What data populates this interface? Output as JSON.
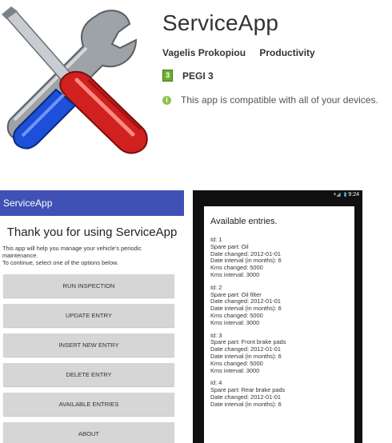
{
  "app": {
    "title": "ServiceApp",
    "developer": "Vagelis Prokopiou",
    "category": "Productivity",
    "rating_badge": "3",
    "rating": "PEGI 3",
    "compat_icon": "info-icon",
    "compatibility": "This app is compatible with all of your devices."
  },
  "screenshot1": {
    "appbar_title": "ServiceApp",
    "heading": "Thank you for using ServiceApp",
    "intro_line1": "This app will help you manage your vehicle's periodic",
    "intro_line2": "maintenance.",
    "intro_line3": "To continue, select one of the options below.",
    "buttons": [
      "RUN INSPECTION",
      "UPDATE ENTRY",
      "INSERT NEW ENTRY",
      "DELETE ENTRY",
      "AVAILABLE ENTRIES",
      "ABOUT"
    ]
  },
  "screenshot2": {
    "status_time": "9:24",
    "title": "Available entries.",
    "entries": [
      {
        "id": "Id: 1",
        "part": "Spare part: Oil",
        "date": "Date changed: 2012-01-01",
        "interval": "Date interval (in months): 6",
        "kms": "Kms changed: 5000",
        "kms_interval": "Kms interval: 3000"
      },
      {
        "id": "Id: 2",
        "part": "Spare part: Oil filter",
        "date": "Date changed: 2012-01-01",
        "interval": "Date interval (in months): 6",
        "kms": "Kms changed: 5000",
        "kms_interval": "Kms interval: 3000"
      },
      {
        "id": "Id: 3",
        "part": "Spare part: Front brake pads",
        "date": "Date changed: 2012-01-01",
        "interval": "Date interval (in months): 6",
        "kms": "Kms changed: 5000",
        "kms_interval": "Kms interval: 3000"
      },
      {
        "id": "Id: 4",
        "part": "Spare part: Rear brake pads",
        "date": "Date changed: 2012-01-01",
        "interval": "Date interval (in months): 6",
        "kms": "",
        "kms_interval": ""
      }
    ]
  },
  "colors": {
    "appbar": "#3f51b5",
    "button": "#d6d6d6",
    "pegi": "#6ab02e",
    "info": "#8bc34a"
  }
}
